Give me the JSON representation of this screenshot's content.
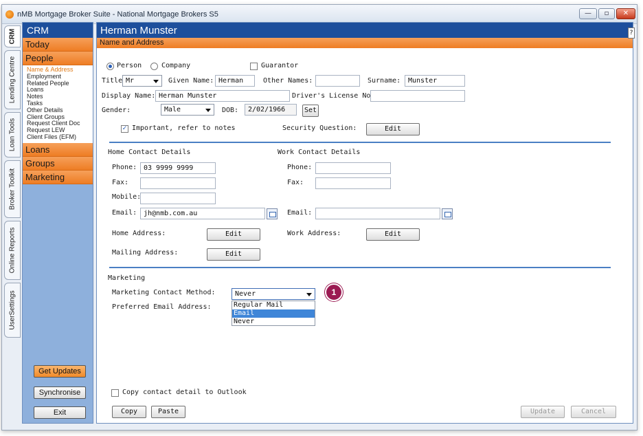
{
  "window": {
    "title": "nMB Mortgage Broker Suite - National Mortgage Brokers S5",
    "minimize_glyph": "—",
    "maximize_glyph": "▫",
    "close_glyph": "✕"
  },
  "vertical_tabs": [
    "CRM",
    "Lending Centre",
    "Loan Tools",
    "Broker Toolkit",
    "Online Reports",
    "UserSettings"
  ],
  "sidebar": {
    "header": "CRM",
    "categories": {
      "today": "Today",
      "people": "People",
      "loans": "Loans",
      "groups": "Groups",
      "marketing": "Marketing"
    },
    "people_items": [
      "Name & Address",
      "Employment",
      "Related People",
      "Loans",
      "Notes",
      "Tasks",
      "Other Details",
      "Client Groups",
      "Request Client Doc",
      "Request LEW",
      "Client Files (EFM)"
    ],
    "buttons": {
      "get_updates": "Get Updates",
      "synchronise": "Synchronise",
      "exit": "Exit"
    }
  },
  "main": {
    "person_name": "Herman Munster",
    "section": "Name and Address",
    "help": "?"
  },
  "form": {
    "type_person": "Person",
    "type_company": "Company",
    "guarantor": "Guarantor",
    "title_label": "Title:",
    "title_value": "Mr",
    "given_name_label": "Given Name:",
    "given_name_value": "Herman",
    "other_names_label": "Other Names:",
    "other_names_value": "",
    "surname_label": "Surname:",
    "surname_value": "Munster",
    "display_name_label": "Display Name:",
    "display_name_value": "Herman Munster",
    "drivers_license_label": "Driver's License No:",
    "drivers_license_value": "",
    "gender_label": "Gender:",
    "gender_value": "Male",
    "dob_label": "DOB:",
    "dob_value": "2/02/1966",
    "set_button": "Set",
    "important_label": "Important, refer to notes",
    "security_question_label": "Security Question:",
    "edit_button": "Edit",
    "home_contact_heading": "Home Contact Details",
    "work_contact_heading": "Work Contact Details",
    "phone_label": "Phone:",
    "fax_label": "Fax:",
    "mobile_label": "Mobile:",
    "email_label": "Email:",
    "home_phone_value": "03 9999 9999",
    "home_fax_value": "",
    "home_mobile_value": "",
    "home_email_value": "jh@nmb.com.au",
    "work_phone_value": "",
    "work_fax_value": "",
    "work_email_value": "",
    "home_address_label": "Home Address:",
    "work_address_label": "Work Address:",
    "mailing_address_label": "Mailing Address:",
    "marketing_heading": "Marketing",
    "marketing_contact_label": "Marketing Contact Method:",
    "marketing_contact_value": "Never",
    "preferred_email_label": "Preferred Email Address:",
    "dropdown_options": [
      "Regular Mail",
      "Email",
      "Never"
    ],
    "dropdown_highlighted": "Email",
    "copy_outlook_label": "Copy contact detail to Outlook",
    "copy_button": "Copy",
    "paste_button": "Paste",
    "update_button": "Update",
    "cancel_button": "Cancel"
  },
  "annotation": {
    "step_number": "1"
  },
  "colors": {
    "accent_blue": "#1d4f9c",
    "accent_orange": "#ee7d24",
    "sidebar_bg": "#8eb0dc",
    "badge": "#9b1a52"
  }
}
